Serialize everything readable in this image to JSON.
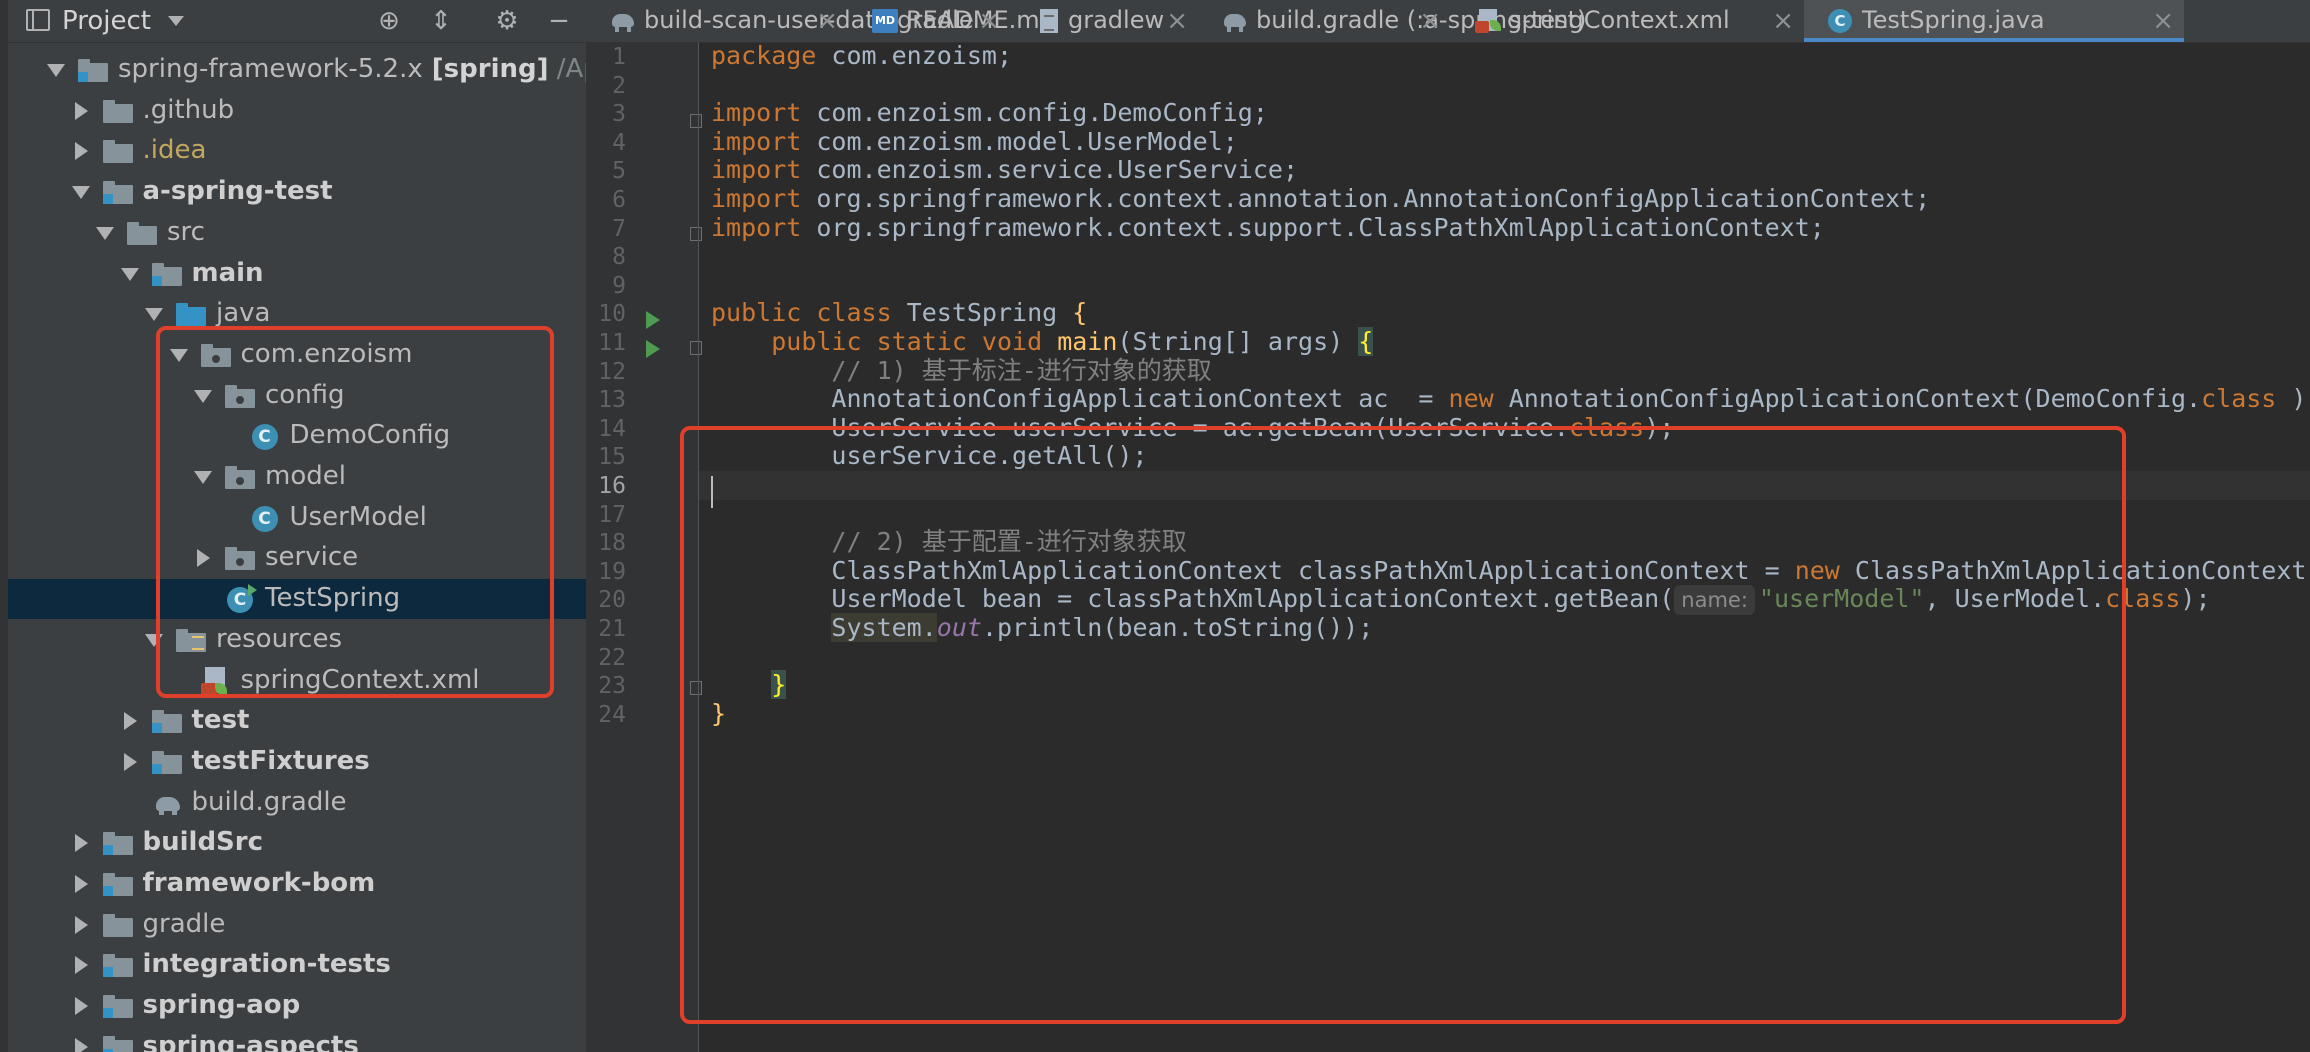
{
  "project_panel": {
    "title": "Project",
    "icons": [
      "locate-icon",
      "collapse-all-icon",
      "gear-icon",
      "hide-icon"
    ]
  },
  "tree": [
    {
      "label": "spring-framework-5.2.x",
      "bold_suffix": " [spring]",
      "path": " /Applic",
      "depth": 0,
      "arrow": "down",
      "icon": "module"
    },
    {
      "label": ".github",
      "depth": 1,
      "arrow": "right",
      "icon": "folder"
    },
    {
      "label": ".idea",
      "depth": 1,
      "arrow": "right",
      "icon": "folder",
      "style": "idea"
    },
    {
      "label": "a-spring-test",
      "depth": 1,
      "arrow": "down",
      "icon": "module",
      "bold": true
    },
    {
      "label": "src",
      "depth": 2,
      "arrow": "down",
      "icon": "folder"
    },
    {
      "label": "main",
      "depth": 3,
      "arrow": "down",
      "icon": "module",
      "bold": true
    },
    {
      "label": "java",
      "depth": 4,
      "arrow": "down",
      "icon": "src-folder"
    },
    {
      "label": "com.enzoism",
      "depth": 5,
      "arrow": "down",
      "icon": "package"
    },
    {
      "label": "config",
      "depth": 6,
      "arrow": "down",
      "icon": "package"
    },
    {
      "label": "DemoConfig",
      "depth": 7,
      "arrow": "none",
      "icon": "class"
    },
    {
      "label": "model",
      "depth": 6,
      "arrow": "down",
      "icon": "package"
    },
    {
      "label": "UserModel",
      "depth": 7,
      "arrow": "none",
      "icon": "class"
    },
    {
      "label": "service",
      "depth": 6,
      "arrow": "right",
      "icon": "package"
    },
    {
      "label": "TestSpring",
      "depth": 6,
      "arrow": "none",
      "icon": "class-run",
      "selected": true
    },
    {
      "label": "resources",
      "depth": 4,
      "arrow": "down",
      "icon": "resources"
    },
    {
      "label": "springContext.xml",
      "depth": 5,
      "arrow": "none",
      "icon": "xml"
    },
    {
      "label": "test",
      "depth": 3,
      "arrow": "right",
      "icon": "module",
      "bold": true
    },
    {
      "label": "testFixtures",
      "depth": 3,
      "arrow": "right",
      "icon": "module",
      "bold": true
    },
    {
      "label": "build.gradle",
      "depth": 3,
      "arrow": "none",
      "icon": "gradle"
    },
    {
      "label": "buildSrc",
      "depth": 1,
      "arrow": "right",
      "icon": "module",
      "bold": true
    },
    {
      "label": "framework-bom",
      "depth": 1,
      "arrow": "right",
      "icon": "module",
      "bold": true
    },
    {
      "label": "gradle",
      "depth": 1,
      "arrow": "right",
      "icon": "folder"
    },
    {
      "label": "integration-tests",
      "depth": 1,
      "arrow": "right",
      "icon": "module",
      "bold": true
    },
    {
      "label": "spring-aop",
      "depth": 1,
      "arrow": "right",
      "icon": "module",
      "bold": true
    },
    {
      "label": "spring-aspects",
      "depth": 1,
      "arrow": "right",
      "icon": "module",
      "bold": true
    }
  ],
  "tabs": [
    {
      "label": "build-scan-user-data.gradle",
      "icon": "gradle-icon",
      "close": "×"
    },
    {
      "label": "README.md",
      "icon": "markdown-icon",
      "icon_text": "MD",
      "close": "×"
    },
    {
      "label": "gradlew",
      "icon": "file-icon",
      "close": "×"
    },
    {
      "label": "build.gradle (:a-spring-test)",
      "icon": "gradle-icon",
      "close": "×"
    },
    {
      "label": "springContext.xml",
      "icon": "xml-icon",
      "close": "×"
    },
    {
      "label": "TestSpring.java",
      "icon": "class-icon",
      "icon_text": "C",
      "close": "×",
      "active": true
    }
  ],
  "editor": {
    "current_line": 16,
    "lines": [
      {
        "n": "1",
        "tokens": [
          [
            "kw",
            "package "
          ],
          [
            "",
            "com.enzoism;"
          ]
        ]
      },
      {
        "n": "2",
        "tokens": []
      },
      {
        "n": "3",
        "tokens": [
          [
            "kw",
            "import "
          ],
          [
            "",
            "com.enzoism.config.DemoConfig;"
          ]
        ],
        "fold": true
      },
      {
        "n": "4",
        "tokens": [
          [
            "kw",
            "import "
          ],
          [
            "",
            "com.enzoism.model.UserModel;"
          ]
        ]
      },
      {
        "n": "5",
        "tokens": [
          [
            "kw",
            "import "
          ],
          [
            "",
            "com.enzoism.service.UserService;"
          ]
        ]
      },
      {
        "n": "6",
        "tokens": [
          [
            "kw",
            "import "
          ],
          [
            "",
            "org.springframework.context.annotation.AnnotationConfigApplicationContext;"
          ]
        ]
      },
      {
        "n": "7",
        "tokens": [
          [
            "kw",
            "import "
          ],
          [
            "",
            "org.springframework.context.support.ClassPathXmlApplicationContext;"
          ]
        ],
        "fold": true
      },
      {
        "n": "8",
        "tokens": []
      },
      {
        "n": "9",
        "tokens": []
      },
      {
        "n": "10",
        "tokens": [
          [
            "kw",
            "public class "
          ],
          [
            "",
            "TestSpring "
          ],
          [
            "fn",
            "{"
          ]
        ],
        "run": true
      },
      {
        "n": "11",
        "tokens": [
          [
            "",
            "    "
          ],
          [
            "kw",
            "public static void "
          ],
          [
            "fn",
            "main"
          ],
          [
            "",
            "(String[] args) "
          ],
          [
            "brace",
            "{"
          ]
        ],
        "run": true,
        "fold": true
      },
      {
        "n": "12",
        "tokens": [
          [
            "",
            "        "
          ],
          [
            "cm",
            "// 1) 基于标注-进行对象的获取"
          ]
        ]
      },
      {
        "n": "13",
        "tokens": [
          [
            "",
            "        AnnotationConfigApplicationContext ac  = "
          ],
          [
            "kw",
            "new "
          ],
          [
            "",
            "AnnotationConfigApplicationContext(DemoConfig."
          ],
          [
            "kw",
            "class"
          ],
          [
            "",
            " );"
          ]
        ]
      },
      {
        "n": "14",
        "tokens": [
          [
            "",
            "        UserService userService = ac.getBean(UserService."
          ],
          [
            "kw",
            "class"
          ],
          [
            "",
            ");"
          ]
        ]
      },
      {
        "n": "15",
        "tokens": [
          [
            "",
            "        userService.getAll();"
          ]
        ]
      },
      {
        "n": "16",
        "tokens": []
      },
      {
        "n": "17",
        "tokens": []
      },
      {
        "n": "18",
        "tokens": [
          [
            "",
            "        "
          ],
          [
            "cm",
            "// 2) 基于配置-进行对象获取"
          ]
        ]
      },
      {
        "n": "19",
        "tokens": [
          [
            "",
            "        ClassPathXmlApplicationContext classPathXmlApplicationContext = "
          ],
          [
            "kw",
            "new "
          ],
          [
            "",
            "ClassPathXmlApplicationContext(\"springContext.xml\");"
          ]
        ]
      },
      {
        "n": "20",
        "tokens": [
          [
            "",
            "        UserModel bean = classPathXmlApplicationContext.getBean("
          ],
          [
            "hint",
            "name:"
          ],
          [
            "st",
            "\"userModel\""
          ],
          [
            "",
            ", UserModel."
          ],
          [
            "kw",
            "class"
          ],
          [
            "",
            ");"
          ]
        ]
      },
      {
        "n": "21",
        "tokens": [
          [
            "",
            "        "
          ],
          [
            "unused",
            "System."
          ],
          [
            "fld",
            "out"
          ],
          [
            "",
            ".println(bean.toString());"
          ]
        ]
      },
      {
        "n": "22",
        "tokens": []
      },
      {
        "n": "23",
        "tokens": [
          [
            "",
            "    "
          ],
          [
            "brace",
            "}"
          ]
        ],
        "fold": true
      },
      {
        "n": "24",
        "tokens": [
          [
            "fn",
            "}"
          ]
        ]
      }
    ]
  }
}
